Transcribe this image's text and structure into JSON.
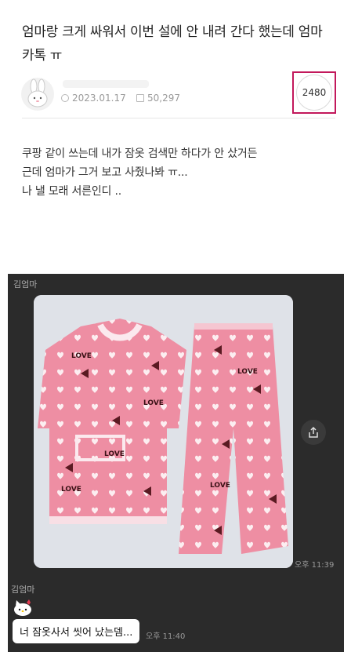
{
  "post": {
    "title": "엄마랑 크게 싸워서 이번 설에 안 내려 간다 했는데 엄마 카톡 ㅠ",
    "date": "2023.01.17",
    "views": "50,297",
    "comment_count": "2480",
    "body_lines": [
      "쿠팡 같이 쓰는데 내가 잠옷 검색만 하다가 안 샀거든",
      "근데 엄마가 그거 보고 사줬나봐 ㅠ...",
      "나 낼 모래 서른인디 .."
    ]
  },
  "chat": {
    "sender1": "김엄마",
    "time1": "오후 11:39",
    "sender2": "김엄마",
    "message": "너 잠옷사서 씻어 났는뎀...",
    "time2": "오후 11:40",
    "pajama_labels": [
      "LOVE",
      "LOVE",
      "LOVE",
      "LOVE",
      "LOVE",
      "LOVE"
    ]
  },
  "colors": {
    "highlight": "#c2185b",
    "pajama_pink": "#ef8fa4",
    "chat_bg": "#2b2b2b"
  }
}
